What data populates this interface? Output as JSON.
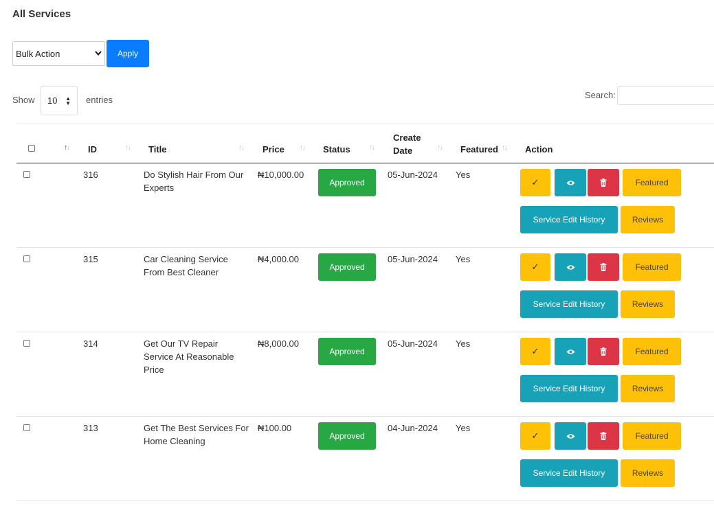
{
  "page": {
    "title": "All Services"
  },
  "bulk": {
    "selected": "Bulk Action",
    "apply_label": "Apply"
  },
  "length": {
    "show_label": "Show",
    "value": "10",
    "entries_label": "entries"
  },
  "search": {
    "label": "Search:",
    "value": ""
  },
  "table": {
    "columns": [
      "ID",
      "Title",
      "Price",
      "Status",
      "Create Date",
      "Featured",
      "Action"
    ],
    "create_date_line1": "Create",
    "create_date_line2": "Date",
    "rows": [
      {
        "id": "316",
        "title": "Do Stylish Hair From Our Experts",
        "price": "₦10,000.00",
        "status": "Approved",
        "date": "05-Jun-2024",
        "featured": "Yes"
      },
      {
        "id": "315",
        "title": "Car Cleaning Service From Best Cleaner",
        "price": "₦4,000.00",
        "status": "Approved",
        "date": "05-Jun-2024",
        "featured": "Yes"
      },
      {
        "id": "314",
        "title": "Get Our TV Repair Service At Reasonable Price",
        "price": "₦8,000.00",
        "status": "Approved",
        "date": "05-Jun-2024",
        "featured": "Yes"
      },
      {
        "id": "313",
        "title": "Get The Best Services For Home Cleaning",
        "price": "₦100.00",
        "status": "Approved",
        "date": "04-Jun-2024",
        "featured": "Yes"
      }
    ]
  },
  "actions": {
    "check_glyph": "✓",
    "featured_label": "Featured",
    "history_label": "Service Edit History",
    "reviews_label": "Reviews"
  },
  "colors": {
    "primary": "#0a7cff",
    "success": "#28a745",
    "warning": "#ffc107",
    "info": "#17a2b8",
    "danger": "#dc3545"
  }
}
